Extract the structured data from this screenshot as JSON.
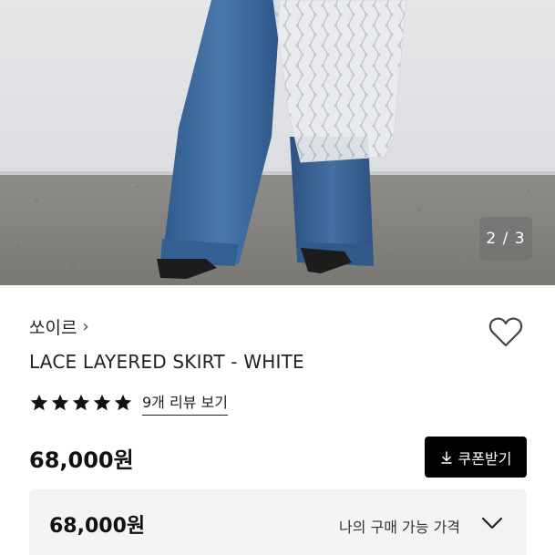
{
  "hero": {
    "pager": "2 / 3"
  },
  "brand": {
    "name": "쏘이르",
    "chevron": "›"
  },
  "product": {
    "title": "LACE LAYERED SKIRT - WHITE",
    "rating": 5,
    "review_link": "9개 리뷰 보기",
    "price": "68,000원"
  },
  "coupon": {
    "label": "쿠폰받기",
    "icon": "download-icon"
  },
  "price_panel": {
    "price": "68,000원",
    "label": "나의 구매 가능 가격",
    "icon": "chevron-down-icon"
  },
  "colors": {
    "denim": "#3d6a9e",
    "button": "#000000",
    "panel": "#f4f4f6"
  }
}
